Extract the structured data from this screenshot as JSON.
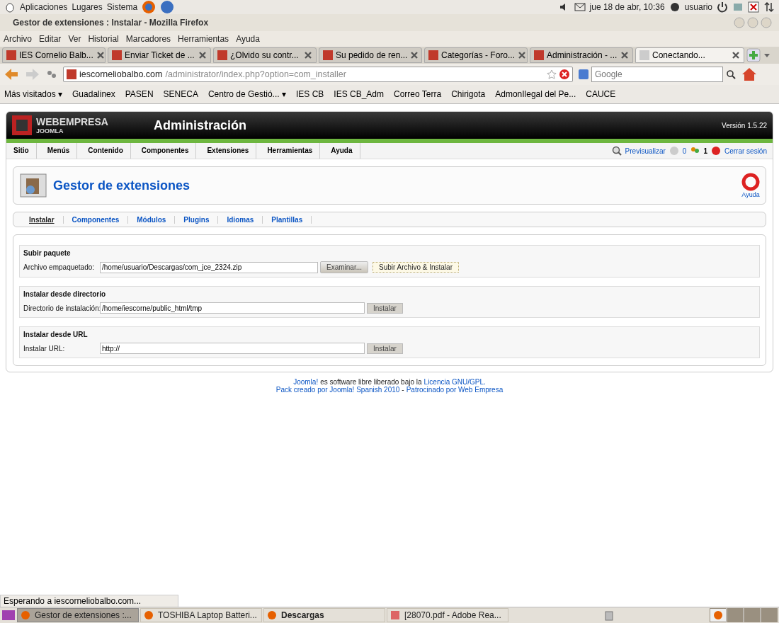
{
  "top_panel": {
    "menus": [
      "Aplicaciones",
      "Lugares",
      "Sistema"
    ],
    "clock": "jue 18 de abr, 10:36",
    "user": "usuario"
  },
  "window": {
    "title": "Gestor de extensiones : Instalar - Mozilla Firefox"
  },
  "menubar": [
    "Archivo",
    "Editar",
    "Ver",
    "Historial",
    "Marcadores",
    "Herramientas",
    "Ayuda"
  ],
  "tabs": [
    {
      "label": "IES Cornelio Balb...",
      "selected": false
    },
    {
      "label": "Enviar Ticket de ...",
      "selected": false
    },
    {
      "label": "¿Olvido su contr...",
      "selected": false
    },
    {
      "label": "Su pedido de ren...",
      "selected": false
    },
    {
      "label": "Categorías - Foro...",
      "selected": false
    },
    {
      "label": "Administración - ...",
      "selected": false
    },
    {
      "label": "Conectando...",
      "selected": true
    }
  ],
  "address": {
    "host": "iescorneliobalbo.com",
    "path": "/administrator/index.php?option=com_installer"
  },
  "search": {
    "placeholder": "Google"
  },
  "bookmarks": [
    "Más visitados ▾",
    "Guadalinex",
    "PASEN",
    "SENECA",
    "Centro de Gestió... ▾",
    "IES CB",
    "IES CB_Adm",
    "Correo Terra",
    "Chirigota",
    "AdmonIlegal del Pe...",
    "CAUCE"
  ],
  "admin": {
    "brand": "WEBEMPRESA",
    "brand_sub": "JOOMLA",
    "title": "Administración",
    "version": "Versión 1.5.22",
    "menu": [
      "Sitio",
      "Menús",
      "Contenido",
      "Componentes",
      "Extensiones",
      "Herramientas",
      "Ayuda"
    ],
    "preview": "Previsualizar",
    "messages": "0",
    "users": "1",
    "logout": "Cerrar sesión"
  },
  "page": {
    "title": "Gestor de extensiones",
    "help": "Ayuda"
  },
  "subtabs": [
    {
      "label": "Instalar",
      "selected": true
    },
    {
      "label": "Componentes",
      "selected": false
    },
    {
      "label": "Módulos",
      "selected": false
    },
    {
      "label": "Plugins",
      "selected": false
    },
    {
      "label": "Idiomas",
      "selected": false
    },
    {
      "label": "Plantillas",
      "selected": false
    }
  ],
  "sections": [
    {
      "title": "Subir paquete",
      "label": "Archivo empaquetado:",
      "value": "/home/usuario/Descargas/com_jce_2324.zip",
      "buttons": [
        "Examinar...",
        "Subir Archivo & Instalar"
      ]
    },
    {
      "title": "Instalar desde directorio",
      "label": "Directorio de instalación:",
      "value": "/home/iescorne/public_html/tmp",
      "buttons": [
        "Instalar"
      ]
    },
    {
      "title": "Instalar desde URL",
      "label": "Instalar URL:",
      "value": "http://",
      "buttons": [
        "Instalar"
      ]
    }
  ],
  "footer": [
    [
      {
        "kind": "link",
        "text": "Joomla!"
      },
      {
        "kind": "text",
        "text": "es software libre liberado bajo la"
      },
      {
        "kind": "link",
        "text": "Licencia GNU/GPL."
      }
    ],
    [
      {
        "kind": "link",
        "text": "Pack creado por Joomla! Spanish 2010"
      },
      {
        "kind": "text",
        "text": "-"
      },
      {
        "kind": "link",
        "text": "Patrocinado por Web Empresa"
      }
    ]
  ],
  "status_bar": "Esperando a iescorneliobalbo.com...",
  "taskbar": [
    {
      "label": "Gestor de extensiones :...",
      "selected": true,
      "attention": false
    },
    {
      "label": "TOSHIBA Laptop Batteri...",
      "selected": false,
      "attention": false
    },
    {
      "label": "Descargas",
      "selected": false,
      "attention": true
    },
    {
      "label": "[28070.pdf - Adobe Rea...",
      "selected": false,
      "attention": false
    }
  ]
}
